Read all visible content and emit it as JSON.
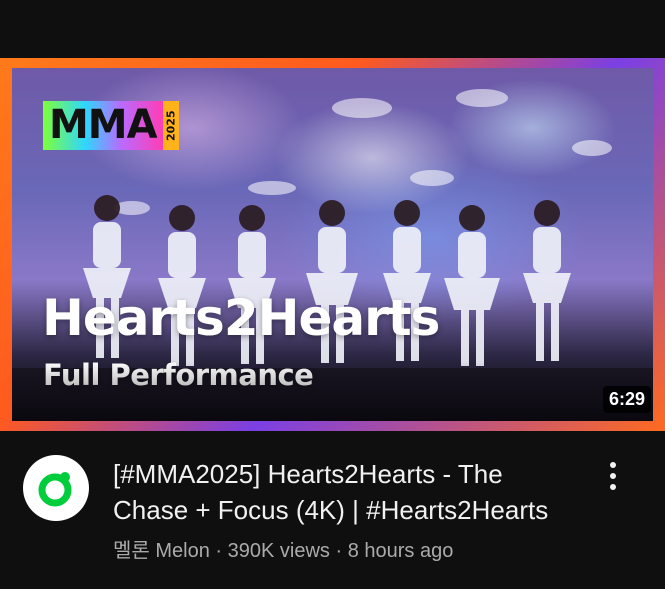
{
  "thumbnail": {
    "logo_text": "MMA",
    "logo_year": "2025",
    "headline": "Hearts2Hearts",
    "subheadline": "Full Performance",
    "duration": "6:29"
  },
  "video": {
    "title": "[#MMA2025] Hearts2Hearts - The Chase + Focus (4K) | #Hearts2Hearts",
    "channel": "멜론 Melon",
    "views": "390K views",
    "age": "8 hours ago",
    "separator": "·"
  },
  "icons": {
    "channel_avatar": "melon-logo-icon",
    "more": "more-vert-icon"
  },
  "colors": {
    "background": "#0f0f0f",
    "frame_orange": "#ff6a20",
    "frame_purple": "#7b3fe4",
    "melon_green": "#00cd3c",
    "title_text": "#f1f1f1",
    "meta_text": "#aaaaaa"
  }
}
